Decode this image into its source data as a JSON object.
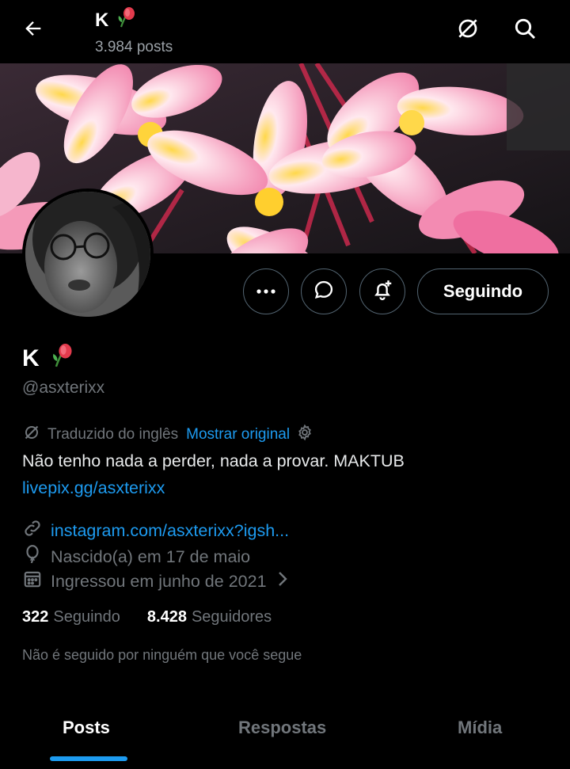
{
  "header": {
    "name": "K",
    "post_count": "3.984 posts",
    "back_icon": "back-arrow-icon",
    "translate_icon": "translate-off-icon",
    "search_icon": "search-icon"
  },
  "profile": {
    "name": "K",
    "handle": "@asxterixx",
    "translated_label": "Traduzido do inglês",
    "show_original": "Mostrar original",
    "bio": "Não tenho nada a perder, nada a provar. MAKTUB",
    "bio_link": "livepix.gg/asxterixx",
    "website": "instagram.com/asxterixx?igsh...",
    "birthday": "Nascido(a) em 17 de maio",
    "joined": "Ingressou em junho de 2021"
  },
  "actions": {
    "follow_label": "Seguindo",
    "more_icon": "more-icon",
    "message_icon": "message-icon",
    "notify_icon": "bell-plus-icon"
  },
  "stats": {
    "following_count": "322",
    "following_label": "Seguindo",
    "followers_count": "8.428",
    "followers_label": "Seguidores",
    "not_followed": "Não é seguido por ninguém que você segue"
  },
  "tabs": [
    {
      "label": "Posts",
      "active": true
    },
    {
      "label": "Respostas",
      "active": false
    },
    {
      "label": "Mídia",
      "active": false
    }
  ],
  "colors": {
    "accent": "#1d9bf0",
    "muted": "#71767b",
    "background": "#000000"
  }
}
